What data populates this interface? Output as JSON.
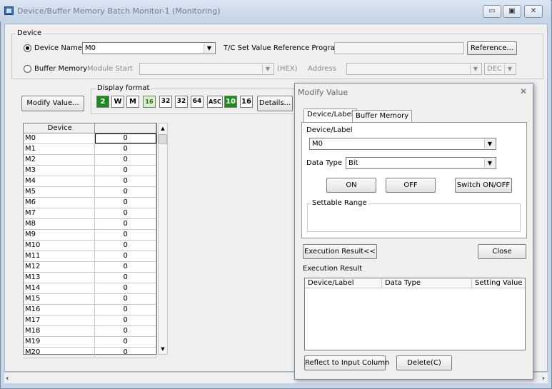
{
  "window": {
    "title": "Device/Buffer Memory Batch Monitor-1 (Monitoring)",
    "minimize_glyph": "▭",
    "maximize_glyph": "▣",
    "close_glyph": "✕"
  },
  "device_group": {
    "label": "Device",
    "device_name_radio": "Device Name",
    "device_name_value": "M0",
    "tc_label": "T/C Set Value Reference Program",
    "tc_value": "",
    "reference_button": "Reference...",
    "buffer_memory_radio": "Buffer Memory",
    "module_start_label": "Module Start",
    "module_start_value": "",
    "hex_label": "(HEX)",
    "address_label": "Address",
    "address_value": "",
    "dec_select": "DEC"
  },
  "toolbar": {
    "modify_value_button": "Modify Value...",
    "display_format_label": "Display format",
    "formats": [
      "2",
      "W",
      "M",
      "16",
      "32",
      "32",
      "64",
      "ASC",
      "10",
      "16"
    ],
    "details_button": "Details..."
  },
  "table": {
    "columns": [
      "Device",
      ""
    ],
    "rows": [
      {
        "device": "M0",
        "value": "0"
      },
      {
        "device": "M1",
        "value": "0"
      },
      {
        "device": "M2",
        "value": "0"
      },
      {
        "device": "M3",
        "value": "0"
      },
      {
        "device": "M4",
        "value": "0"
      },
      {
        "device": "M5",
        "value": "0"
      },
      {
        "device": "M6",
        "value": "0"
      },
      {
        "device": "M7",
        "value": "0"
      },
      {
        "device": "M8",
        "value": "0"
      },
      {
        "device": "M9",
        "value": "0"
      },
      {
        "device": "M10",
        "value": "0"
      },
      {
        "device": "M11",
        "value": "0"
      },
      {
        "device": "M12",
        "value": "0"
      },
      {
        "device": "M13",
        "value": "0"
      },
      {
        "device": "M14",
        "value": "0"
      },
      {
        "device": "M15",
        "value": "0"
      },
      {
        "device": "M16",
        "value": "0"
      },
      {
        "device": "M17",
        "value": "0"
      },
      {
        "device": "M18",
        "value": "0"
      },
      {
        "device": "M19",
        "value": "0"
      },
      {
        "device": "M20",
        "value": "0"
      }
    ]
  },
  "dialog": {
    "title": "Modify Value",
    "close_glyph": "✕",
    "tabs": [
      "Device/Label",
      "Buffer Memory"
    ],
    "device_label_caption": "Device/Label",
    "device_label_value": "M0",
    "data_type_label": "Data Type",
    "data_type_value": "Bit",
    "on_button": "ON",
    "off_button": "OFF",
    "switch_button": "Switch ON/OFF",
    "settable_range_label": "Settable Range",
    "exec_result_toggle": "Execution Result<<",
    "close_button": "Close",
    "exec_result_label": "Execution Result",
    "result_columns": [
      "Device/Label",
      "Data Type",
      "Setting Value"
    ],
    "reflect_button": "Reflect to Input Column",
    "delete_button": "Delete(C)"
  },
  "colors": {
    "accent_green": "#1e8a1e",
    "titlebar": "#c4d3e6"
  }
}
